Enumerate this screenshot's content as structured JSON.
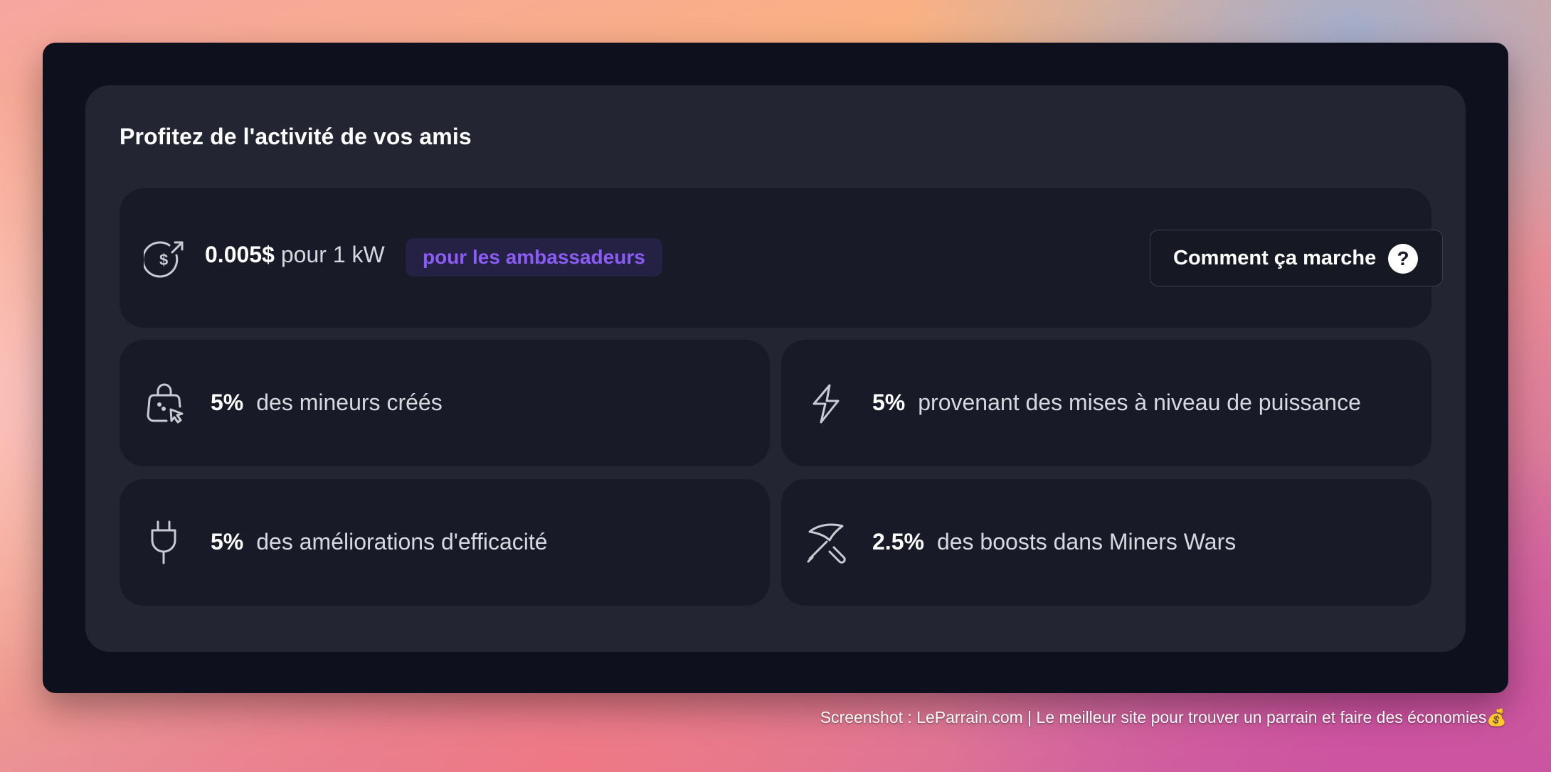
{
  "panel": {
    "title": "Profitez de l'activité de vos amis"
  },
  "rate_card": {
    "rate_value": "0.005$",
    "rate_unit": "pour 1 kW",
    "badge": "pour les ambassadeurs",
    "how_button_label": "Comment ça marche",
    "help_icon_glyph": "?"
  },
  "features": [
    {
      "percent": "5%",
      "label": "des mineurs créés",
      "icon": "shopping-bag-cursor-icon"
    },
    {
      "percent": "5%",
      "label": "provenant des mises à niveau de puissance",
      "icon": "lightning-bolt-icon"
    },
    {
      "percent": "5%",
      "label": "des améliorations d'efficacité",
      "icon": "plug-icon"
    },
    {
      "percent": "2.5%",
      "label": "des boosts dans Miners Wars",
      "icon": "pickaxe-icon"
    }
  ],
  "footer": {
    "text": "Screenshot : LeParrain.com | Le meilleur site pour trouver un parrain et faire des économies",
    "emoji": "💰"
  },
  "colors": {
    "window_bg": "#0e101d",
    "panel_bg": "#232632",
    "card_bg": "#181a27",
    "badge_bg": "#252145",
    "badge_text": "#8b5cf6"
  }
}
